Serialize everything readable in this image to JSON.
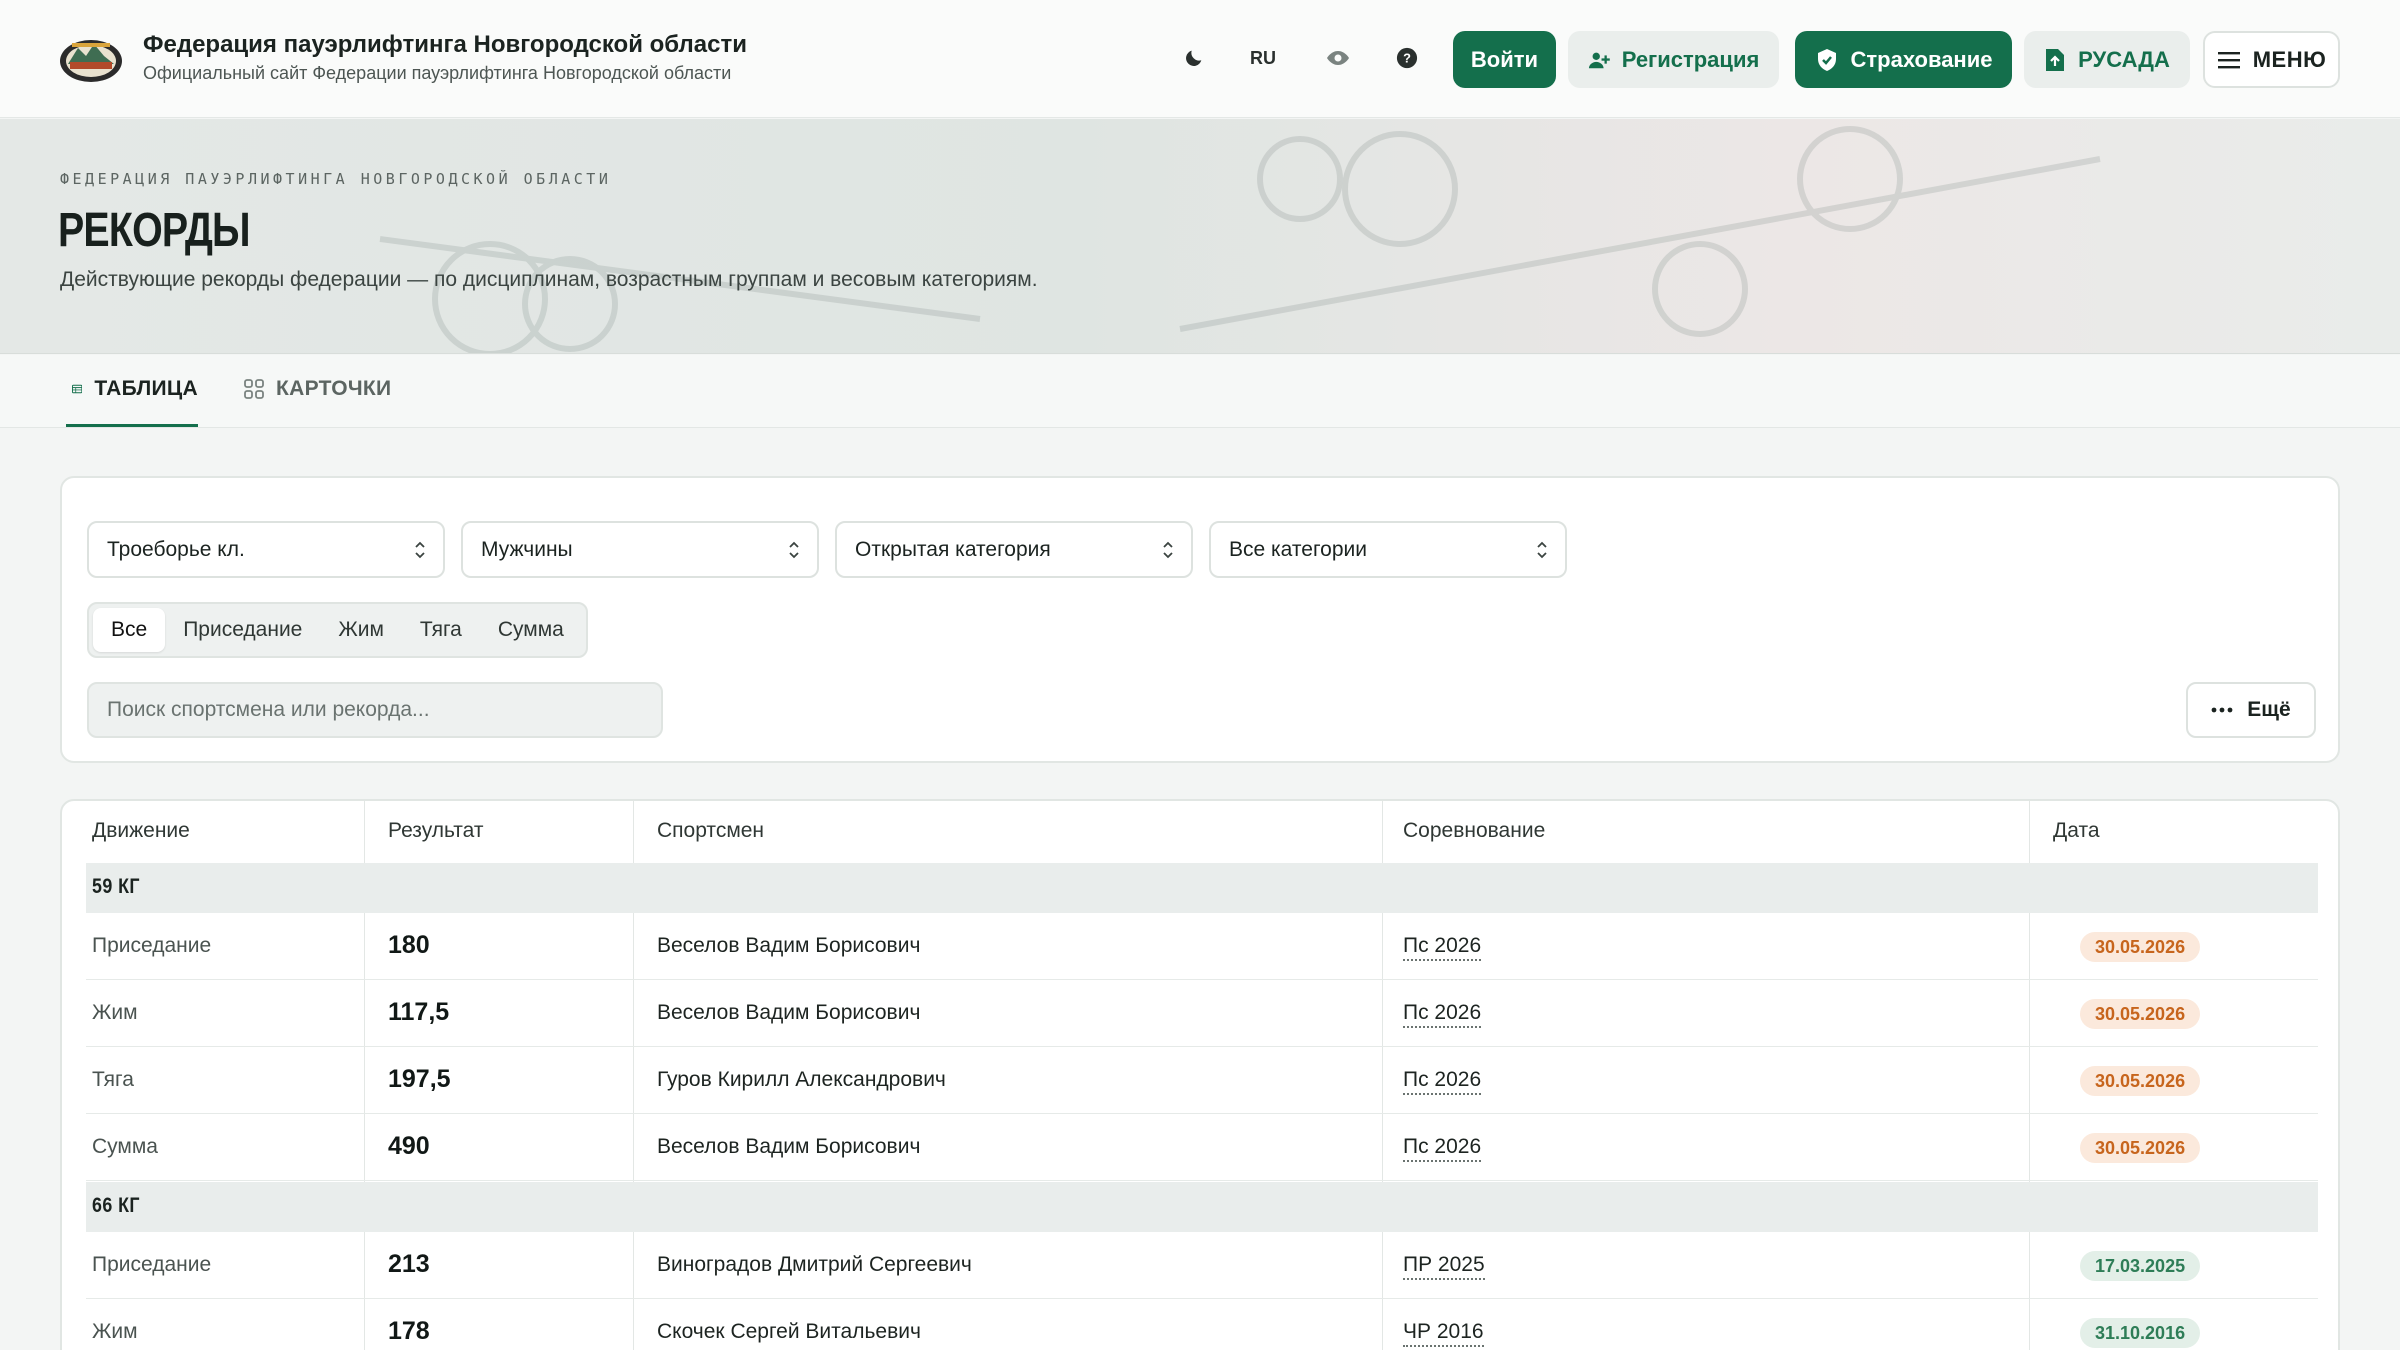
{
  "header": {
    "title": "Федерация пауэрлифтинга Новгородской области",
    "subtitle": "Официальный сайт Федерации пауэрлифтинга Новгородской области",
    "lang": "RU",
    "login": "Войти",
    "register": "Регистрация",
    "insurance": "Страхование",
    "rusada": "РУСАДА",
    "menu": "МЕНЮ"
  },
  "hero": {
    "kicker": "ФЕДЕРАЦИЯ ПАУЭРЛИФТИНГА НОВГОРОДСКОЙ ОБЛАСТИ",
    "title": "РЕКОРДЫ",
    "description": "Действующие рекорды федерации — по дисциплинам, возрастным группам и весовым категориям."
  },
  "tabs": {
    "table": "ТАБЛИЦА",
    "cards": "КАРТОЧКИ"
  },
  "filters": {
    "discipline": "Троеборье кл.",
    "gender": "Мужчины",
    "age": "Открытая категория",
    "weight": "Все категории",
    "segments": [
      "Все",
      "Приседание",
      "Жим",
      "Тяга",
      "Сумма"
    ],
    "search_placeholder": "Поиск спортсмена или рекорда...",
    "more": "Ещё"
  },
  "table": {
    "headers": [
      "Движение",
      "Результат",
      "Спортсмен",
      "Соревнование",
      "Дата"
    ],
    "groups": [
      {
        "label": "59 КГ",
        "rows": [
          {
            "movement": "Приседание",
            "result": "180",
            "athlete": "Веселов Вадим Борисович",
            "competition": "Пс 2026",
            "date": "30.05.2026",
            "tone": "orange"
          },
          {
            "movement": "Жим",
            "result": "117,5",
            "athlete": "Веселов Вадим Борисович",
            "competition": "Пс 2026",
            "date": "30.05.2026",
            "tone": "orange"
          },
          {
            "movement": "Тяга",
            "result": "197,5",
            "athlete": "Гуров Кирилл Александрович",
            "competition": "Пс 2026",
            "date": "30.05.2026",
            "tone": "orange"
          },
          {
            "movement": "Сумма",
            "result": "490",
            "athlete": "Веселов Вадим Борисович",
            "competition": "Пс 2026",
            "date": "30.05.2026",
            "tone": "orange"
          }
        ]
      },
      {
        "label": "66 КГ",
        "rows": [
          {
            "movement": "Приседание",
            "result": "213",
            "athlete": "Виноградов Дмитрий Сергеевич",
            "competition": "ПР 2025",
            "date": "17.03.2025",
            "tone": "green"
          },
          {
            "movement": "Жим",
            "result": "178",
            "athlete": "Скочек Сергей Витальевич",
            "competition": "ЧР 2016",
            "date": "31.10.2016",
            "tone": "green"
          }
        ]
      }
    ]
  },
  "colors": {
    "accent": "#146f4c",
    "date_recent_bg": "#fbe9dc",
    "date_recent_fg": "#c7651d",
    "date_old_bg": "#e3efe8",
    "date_old_fg": "#2e7d57"
  },
  "icons": [
    "moon-icon",
    "eye-icon",
    "help-icon",
    "user-plus-icon",
    "shield-icon",
    "file-icon",
    "hamburger-icon",
    "table-icon",
    "grid-icon",
    "chevron-updown-icon",
    "ellipsis-icon"
  ]
}
